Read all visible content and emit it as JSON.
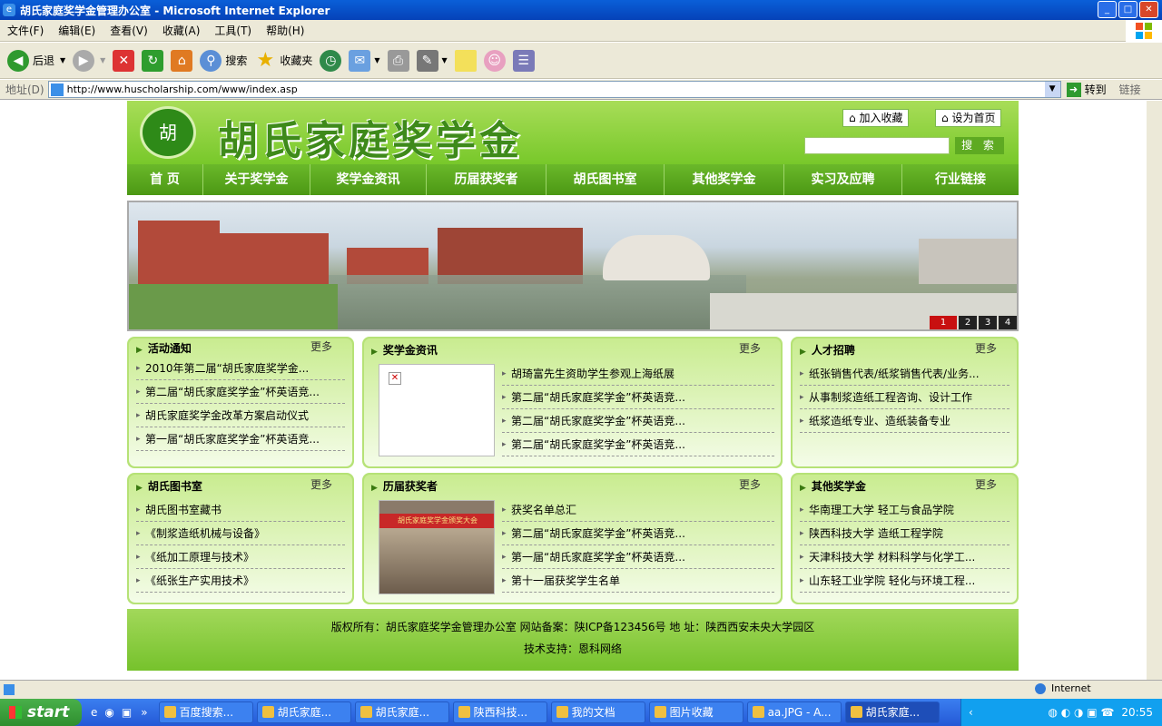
{
  "window": {
    "title": "胡氏家庭奖学金管理办公室",
    "app": "Microsoft Internet Explorer"
  },
  "menu": [
    "文件(F)",
    "编辑(E)",
    "查看(V)",
    "收藏(A)",
    "工具(T)",
    "帮助(H)"
  ],
  "toolbar": {
    "back": "后退",
    "search": "搜索",
    "favorites": "收藏夹"
  },
  "address": {
    "label": "地址(D)",
    "url": "http://www.huscholarship.com/www/index.asp",
    "go": "转到",
    "links": "链接"
  },
  "site": {
    "logo_text": "胡",
    "name": "胡氏家庭奖学金",
    "add_favorite": "加入收藏",
    "set_home": "设为首页",
    "search_btn": "搜 索",
    "nav": [
      "首 页",
      "关于奖学金",
      "奖学金资讯",
      "历届获奖者",
      "胡氏图书室",
      "其他奖学金",
      "实习及应聘",
      "行业链接"
    ],
    "banner_pages": [
      "1",
      "2",
      "3",
      "4"
    ],
    "more": "更多",
    "panels": {
      "activity": {
        "title": "活动通知",
        "items": [
          "2010年第二届“胡氏家庭奖学金...",
          "第二届“胡氏家庭奖学金”杯英语竞...",
          "胡氏家庭奖学金改革方案启动仪式",
          "第一届“胡氏家庭奖学金”杯英语竞..."
        ]
      },
      "news": {
        "title": "奖学金资讯",
        "items": [
          "胡琦富先生资助学生参观上海纸展",
          "第二届“胡氏家庭奖学金”杯英语竞...",
          "第二届“胡氏家庭奖学金”杯英语竞...",
          "第二届“胡氏家庭奖学金”杯英语竞..."
        ]
      },
      "jobs": {
        "title": "人才招聘",
        "items": [
          "纸张销售代表/纸浆销售代表/业务...",
          "从事制浆造纸工程咨询、设计工作",
          "纸浆造纸专业、造纸装备专业"
        ]
      },
      "library": {
        "title": "胡氏图书室",
        "items": [
          "胡氏图书室藏书",
          "《制浆造纸机械与设备》",
          "《纸加工原理与技术》",
          "《纸张生产实用技术》"
        ]
      },
      "winners": {
        "title": "历届获奖者",
        "photo_banner": "胡氏家庭奖学金颁奖大会",
        "items": [
          "获奖名单总汇",
          "第二届“胡氏家庭奖学金”杯英语竞...",
          "第一届“胡氏家庭奖学金”杯英语竞...",
          "第十一届获奖学生名单"
        ]
      },
      "others": {
        "title": "其他奖学金",
        "items": [
          "华南理工大学 轻工与食品学院",
          "陕西科技大学 造纸工程学院",
          "天津科技大学 材料科学与化学工...",
          "山东轻工业学院 轻化与环境工程..."
        ]
      }
    },
    "footer": {
      "line1": "版权所有：胡氏家庭奖学金管理办公室 网站备案：陕ICP备123456号 地 址：陕西西安未央大学园区",
      "line2": "技术支持：恩科网络"
    }
  },
  "status": {
    "zone": "Internet"
  },
  "taskbar": {
    "start": "start",
    "tasks": [
      "百度搜索...",
      "胡氏家庭...",
      "胡氏家庭...",
      "陕西科技...",
      "我的文档",
      "图片收藏",
      "aa.JPG - A...",
      "胡氏家庭..."
    ],
    "clock": "20:55"
  }
}
